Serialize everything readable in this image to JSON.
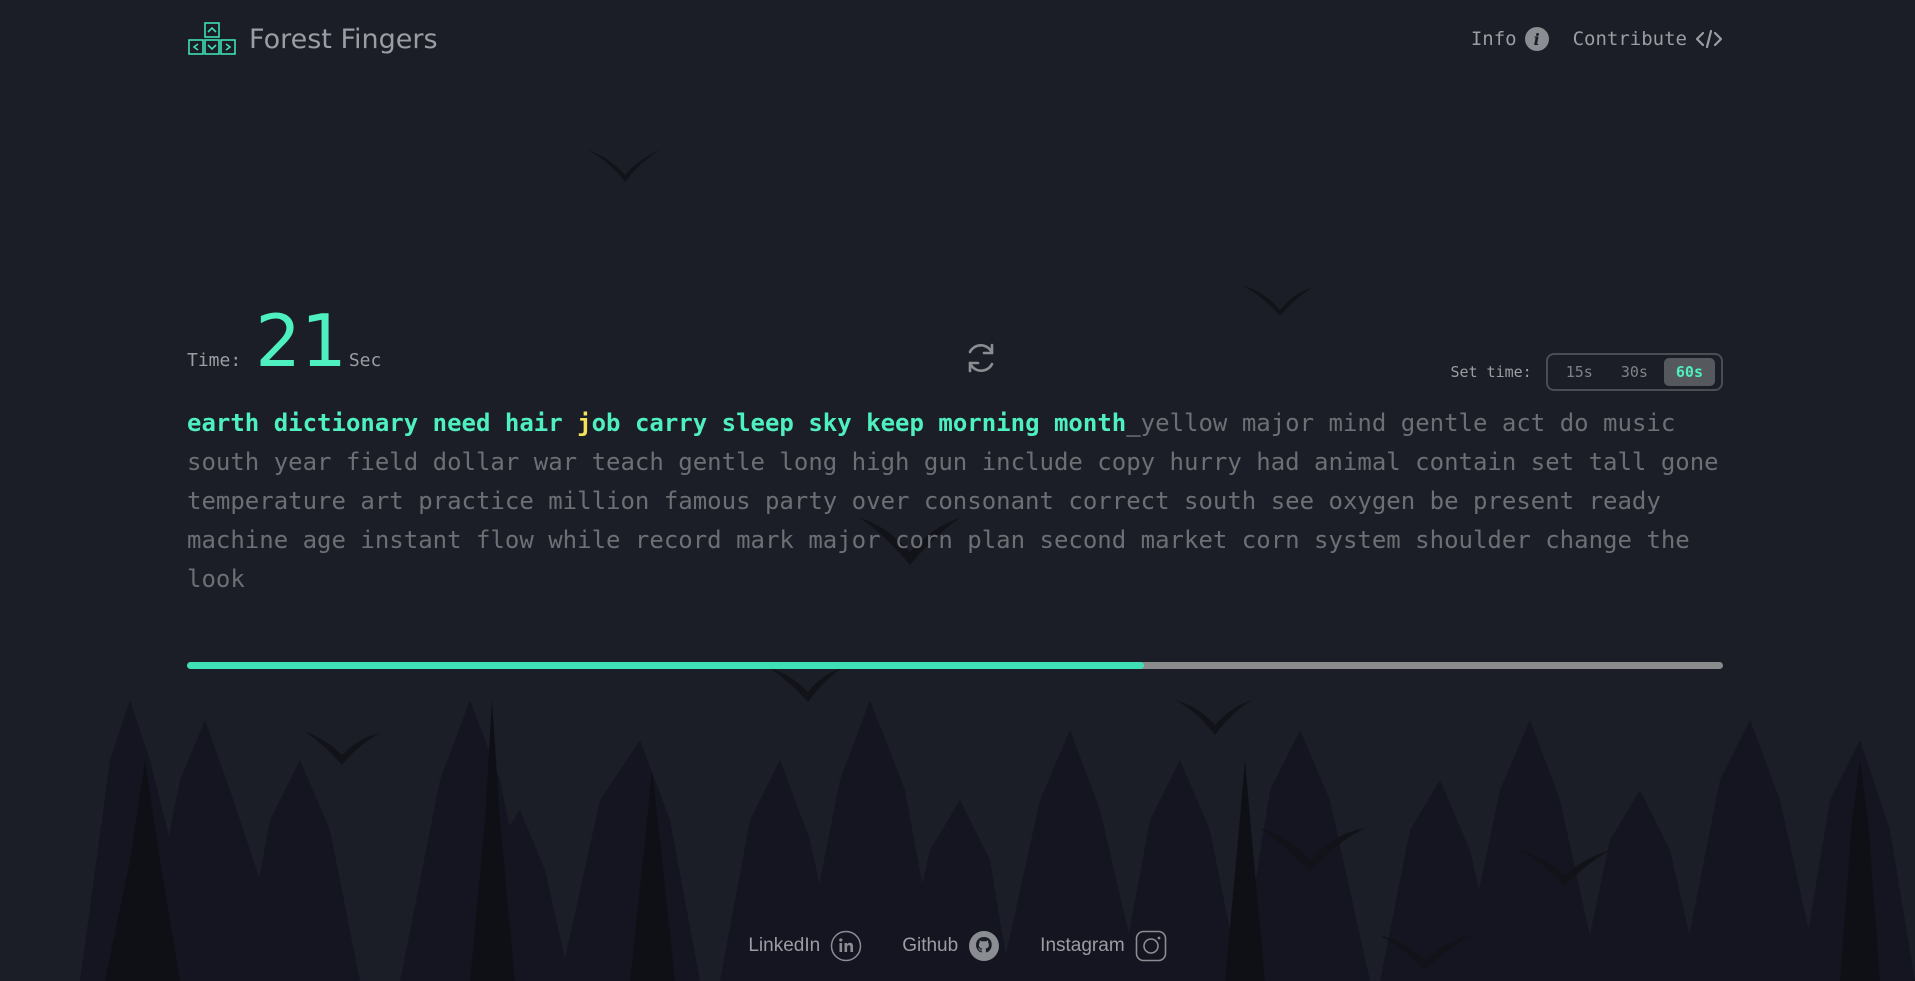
{
  "header": {
    "brand": "Forest Fingers",
    "nav": [
      {
        "label": "Info",
        "icon": "info-icon"
      },
      {
        "label": "Contribute",
        "icon": "code-icon"
      }
    ]
  },
  "timer": {
    "label": "Time:",
    "value": "21",
    "unit": "Sec"
  },
  "set_time": {
    "label": "Set time:",
    "options": [
      "15s",
      "30s",
      "60s"
    ],
    "selected": "60s"
  },
  "text": {
    "typed_before_error": "earth dictionary need hair ",
    "error_char": "j",
    "typed_after_error": "ob carry sleep sky keep morning month",
    "caret": "_",
    "untyped": "yellow major mind gentle act do music south year field dollar war teach gentle long high gun include copy hurry had animal contain set tall gone temperature art practice million famous party over consonant correct south see oxygen be present ready machine age instant flow while record mark major corn plan second market corn system shoulder change the look"
  },
  "progress": {
    "fraction": 0.623
  },
  "footer": {
    "links": [
      {
        "label": "LinkedIn",
        "icon": "linkedin-icon"
      },
      {
        "label": "Github",
        "icon": "github-icon"
      },
      {
        "label": "Instagram",
        "icon": "instagram-icon"
      }
    ]
  },
  "colors": {
    "background": "#1b1e26",
    "accent": "#4ef0c0",
    "error": "#f4e25a",
    "muted": "#6c6f74"
  }
}
